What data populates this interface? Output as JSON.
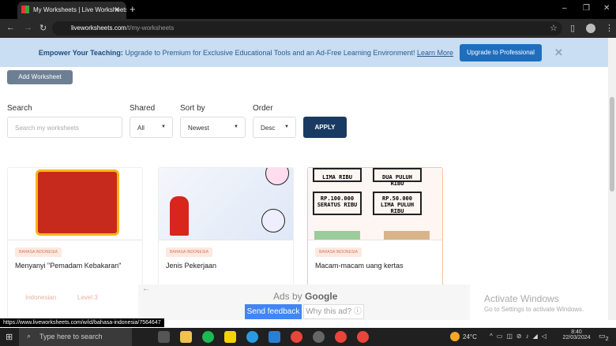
{
  "browser": {
    "tab_title": "My Worksheets | Live Worksheets",
    "url_domain": "liveworksheets.com",
    "url_path": "/t/my-worksheets"
  },
  "banner": {
    "bold": "Empower Your Teaching:",
    "text": " Upgrade to Premium for Exclusive Educational Tools and an Ad-Free Learning Environment! ",
    "link": "Learn More",
    "button": "Upgrade to Professional",
    "close": "✕"
  },
  "add_worksheet": "Add Worksheet",
  "filters": {
    "search_label": "Search",
    "search_placeholder": "Search my worksheets",
    "shared_label": "Shared",
    "shared_value": "All",
    "sort_label": "Sort by",
    "sort_value": "Newest",
    "order_label": "Order",
    "order_value": "Desc",
    "apply": "APPLY"
  },
  "cards": [
    {
      "badge": "BAHASA INDONESIA",
      "title": "Menyanyi \"Pemadam Kebakaran\"",
      "language": "Indonesian",
      "level": "Level 3"
    },
    {
      "badge": "BAHASA INDONESIA",
      "title": "Jenis Pekerjaan"
    },
    {
      "badge": "BAHASA INDONESIA",
      "title": "Macam-macam uang kertas",
      "money": [
        "LIMA RIBU",
        "DUA PULUH RIBU",
        "RP.100.000",
        "SERATUS RIBU",
        "RP.50.000",
        "LIMA PULUH RIBU"
      ]
    }
  ],
  "ad": {
    "ads_by": "Ads by",
    "google": "Google",
    "send_feedback": "Send feedback",
    "why": "Why this ad? ⓘ"
  },
  "activate": {
    "title": "Activate Windows",
    "sub": "Go to Settings to activate Windows."
  },
  "status_url": "https://www.liveworksheets.com/w/id/bahasa-indonesia/7564647",
  "taskbar": {
    "search": "Type here to search",
    "temp": "24°C",
    "time": "8:40",
    "date": "22/03/2024",
    "notif": "2"
  }
}
